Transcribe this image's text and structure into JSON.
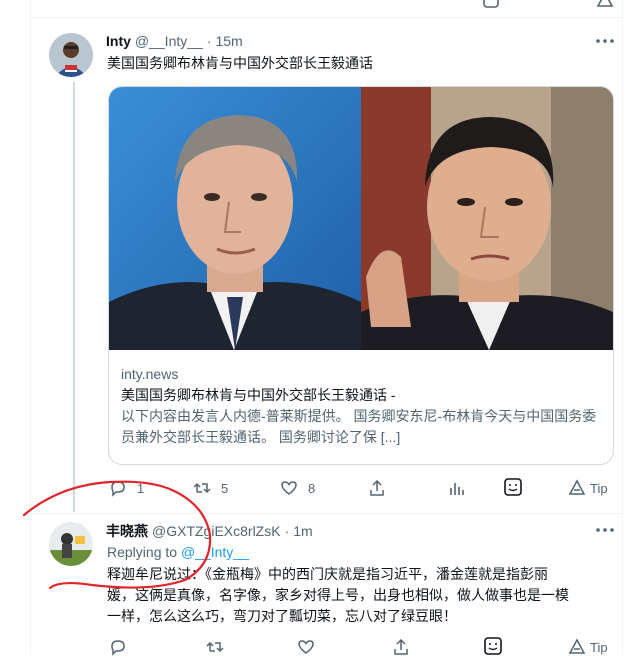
{
  "colors": {
    "accent": "#1d9bf0",
    "muted": "#536471",
    "annotation": "#e0262b"
  },
  "tweet1": {
    "author_name": "Inty",
    "author_handle": "@__Inty__",
    "time": "15m",
    "text": "美国国务卿布林肯与中国外交部长王毅通话",
    "card": {
      "domain": "inty.news",
      "title": "美国国务卿布林肯与中国外交部长王毅通话 -",
      "description": "以下内容由发言人内德-普莱斯提供。 国务卿安东尼-布林肯今天与中国国务委员兼外交部长王毅通话。 国务卿讨论了保 [...]"
    },
    "actions": {
      "reply_count": "1",
      "retweet_count": "5",
      "like_count": "8",
      "tip_label": "Tip"
    }
  },
  "tweet2": {
    "author_name": "丰晓燕",
    "author_handle": "@GXTZgiEXc8rlZsK",
    "time": "1m",
    "replying_prefix": "Replying to",
    "replying_handle": "@__Inty__",
    "text_line1": "释迦牟尼说过：《金瓶梅》中的西门庆就是指习近平，潘金莲就是指彭丽",
    "text_line2": "媛，这俩是真像，名字像，家乡对得上号，出身也相似，做人做事也是一模",
    "text_line3": "一样，怎么这么巧，弯刀对了瓢切菜，忘八对了绿豆眼！",
    "actions": {
      "tip_label": "Tip"
    }
  },
  "icons": [
    "reply-icon",
    "retweet-icon",
    "like-icon",
    "share-icon",
    "analytics-icon",
    "tip-jar-icon",
    "tip-icon",
    "more-icon"
  ]
}
